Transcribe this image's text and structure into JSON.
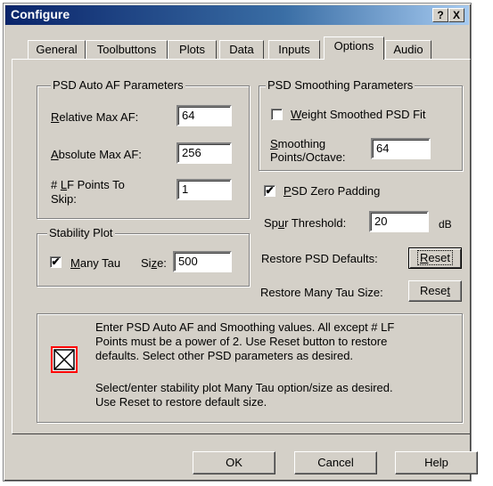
{
  "window": {
    "title": "Configure",
    "help_button": "?",
    "close_button": "X"
  },
  "tabs": [
    "General",
    "Toolbuttons",
    "Plots",
    "Data",
    "Inputs",
    "Options",
    "Audio"
  ],
  "active_tab": "Options",
  "psd_auto_af": {
    "legend": "PSD Auto AF Parameters",
    "relative_label": "Relative Max AF:",
    "relative_value": "64",
    "absolute_label": "Absolute Max AF:",
    "absolute_value": "256",
    "lf_label_line1": "# LF Points To",
    "lf_label_line2": "Skip:",
    "lf_value": "1"
  },
  "psd_smoothing": {
    "legend": "PSD Smoothing Parameters",
    "weight_label": "Weight Smoothed PSD Fit",
    "weight_checked": false,
    "smoothing_label_line1": "Smoothing",
    "smoothing_label_line2": "Points/Octave:",
    "smoothing_value": "64"
  },
  "zero_padding": {
    "label": "PSD Zero Padding",
    "checked": true
  },
  "spur": {
    "label": "Spur Threshold:",
    "value": "20",
    "unit": "dB"
  },
  "restore_psd": {
    "label": "Restore PSD Defaults:",
    "button": "Reset"
  },
  "stability": {
    "legend": "Stability Plot",
    "many_tau_label": "Many Tau",
    "many_tau_checked": true,
    "size_label": "Size:",
    "size_value": "500"
  },
  "restore_tau": {
    "label": "Restore Many Tau Size:",
    "button": "Reset"
  },
  "info": {
    "para1_line1": "Enter PSD Auto AF and Smoothing values.  All except # LF",
    "para1_line2": "Points must be a power of 2.  Use Reset button to restore",
    "para1_line3": "defaults.  Select other PSD parameters as desired.",
    "para2_line1": "Select/enter stability plot Many Tau option/size as desired.",
    "para2_line2": "Use Reset to restore default size."
  },
  "footer": {
    "ok": "OK",
    "cancel": "Cancel",
    "help": "Help"
  }
}
